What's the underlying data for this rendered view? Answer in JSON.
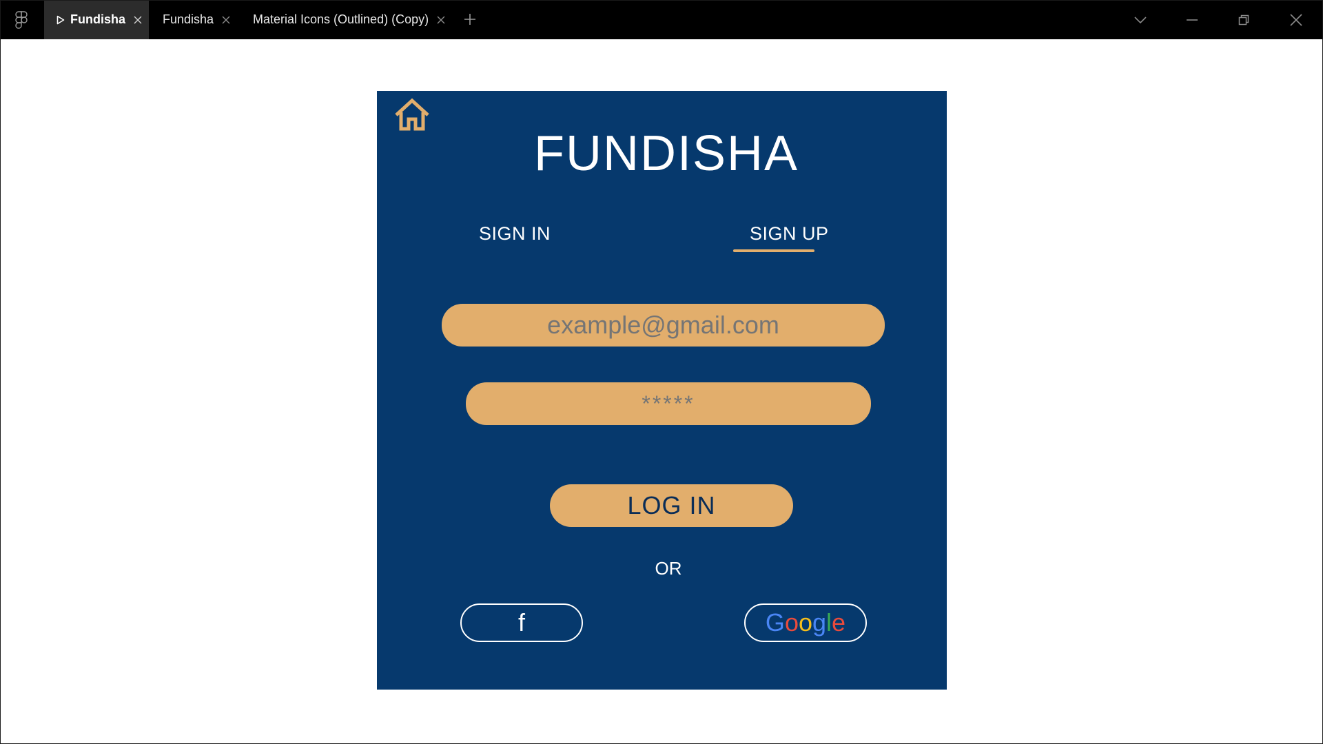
{
  "tabs": [
    {
      "label": "Fundisha",
      "active": true
    },
    {
      "label": "Fundisha",
      "active": false
    },
    {
      "label": "Material Icons (Outlined) (Copy)",
      "active": false
    }
  ],
  "prototype": {
    "brand": "FUNDISHA",
    "tabs": {
      "sign_in": "SIGN IN",
      "sign_up": "SIGN UP"
    },
    "email_placeholder": "example@gmail.com",
    "password_placeholder": "*****",
    "login_label": "LOG IN",
    "or_label": "OR",
    "facebook_label": "f",
    "google_letters": [
      "G",
      "o",
      "o",
      "g",
      "l",
      "e"
    ]
  },
  "colors": {
    "frame_bg": "#06396d",
    "accent": "#e2ae6c",
    "titlebar_bg": "#000000",
    "active_tab_bg": "#2c2c2c"
  },
  "icons": [
    "figma-logo-icon",
    "play-icon",
    "close-icon",
    "add-tab-icon",
    "chevron-down-icon",
    "minimize-icon",
    "restore-icon",
    "close-window-icon",
    "home-icon"
  ]
}
